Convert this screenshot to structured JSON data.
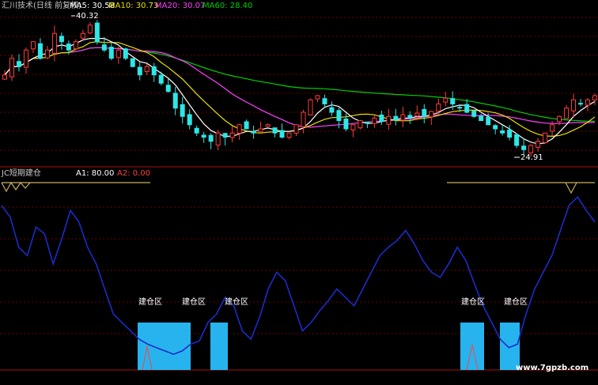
{
  "colors": {
    "background": "#000000",
    "grid": "#6e0000",
    "divider": "#b01010",
    "up_candle": "#ff3b3b",
    "down_candle": "#2ee6e6",
    "ma5": "#ffffff",
    "ma10": "#e8e000",
    "ma20": "#ff40ff",
    "ma60": "#00d000",
    "oscillator": "#1a2cc8",
    "blocks": "#27b4ee",
    "header_text": "#c8c8c8",
    "label_text": "#ffffff",
    "threshold": "#c8b060",
    "watermark": "#ffffff"
  },
  "header": {
    "title": "汇川技术(日线 前复权)",
    "ma5": "MA5: 30.58",
    "ma10": "MA10: 30.73",
    "ma20": "MA20: 30.07",
    "ma60": "MA60: 28.40"
  },
  "sub_header": {
    "title": "JC短期建仓",
    "a1": "A1: 80.00",
    "a2": "A2: 0.00"
  },
  "annotations": {
    "high_price": "40.32",
    "low_price": "24.91"
  },
  "watermark": "www.7gpzb.com",
  "chart_data": [
    {
      "type": "candlestick",
      "series": [
        {
          "name": "MA5",
          "value": 30.58
        },
        {
          "name": "MA10",
          "value": 30.73
        },
        {
          "name": "MA20",
          "value": 30.07
        },
        {
          "name": "MA60",
          "value": 28.4
        }
      ],
      "annotations": [
        {
          "text": "40.32",
          "kind": "high"
        },
        {
          "text": "24.91",
          "kind": "low"
        }
      ],
      "close_trace": [
        34,
        36,
        35,
        37,
        38,
        36,
        37,
        39,
        38,
        37,
        38,
        39,
        40,
        38,
        37,
        36,
        37,
        36,
        35,
        34,
        35,
        34,
        33,
        32,
        30,
        29,
        28,
        27,
        26.5,
        26,
        27,
        26.5,
        27,
        28,
        27.5,
        27,
        27.5,
        28,
        27,
        26.5,
        27,
        28,
        29.5,
        31,
        31.5,
        30.5,
        29.5,
        28.5,
        27.5,
        28,
        28.5,
        28.2,
        28.8,
        28.4,
        29,
        28.6,
        29.2,
        28.8,
        29.4,
        29,
        29.6,
        30.5,
        31.2,
        30.5,
        30,
        29.5,
        29,
        28.5,
        28,
        27.5,
        27,
        26.5,
        25.5,
        25,
        25.5,
        26,
        27,
        28,
        29,
        30,
        31,
        30.5,
        31,
        31.5
      ]
    },
    {
      "type": "line",
      "title": "JC短期建仓",
      "thresholds": [
        {
          "name": "A1",
          "value": 80.0
        },
        {
          "name": "A2",
          "value": 0.0
        }
      ],
      "y_range": [
        -10,
        110
      ],
      "series": [
        {
          "name": "oscillator",
          "values": [
            95,
            88,
            70,
            65,
            82,
            78,
            60,
            75,
            92,
            85,
            70,
            60,
            45,
            30,
            25,
            20,
            15,
            12,
            10,
            8,
            6,
            8,
            12,
            14,
            25,
            30,
            40,
            35,
            20,
            15,
            28,
            45,
            55,
            50,
            35,
            20,
            25,
            32,
            38,
            45,
            40,
            35,
            45,
            55,
            65,
            70,
            74,
            80,
            72,
            62,
            55,
            52,
            60,
            70,
            62,
            48,
            35,
            25,
            15,
            10,
            12,
            30,
            45,
            55,
            65,
            80,
            95,
            100,
            92,
            85
          ]
        }
      ],
      "buy_zones": [
        {
          "label": "建仓区"
        },
        {
          "label": "建仓区"
        },
        {
          "label": "建仓区"
        },
        {
          "label": "建仓区"
        },
        {
          "label": "建仓区"
        }
      ]
    }
  ]
}
